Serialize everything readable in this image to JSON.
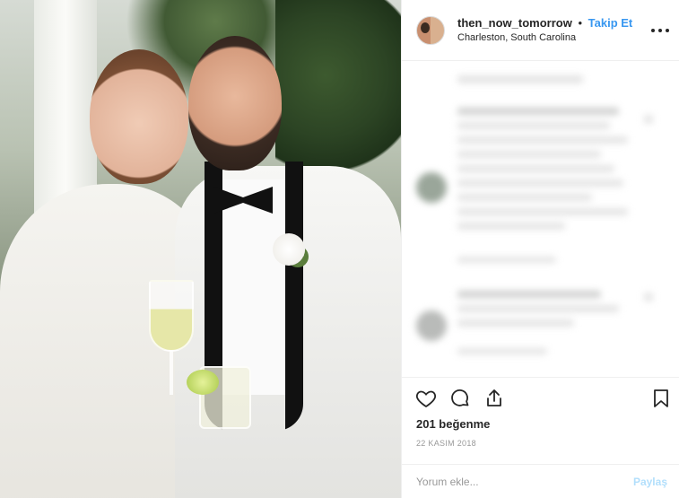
{
  "header": {
    "username": "then_now_tomorrow",
    "separator": "•",
    "follow_label": "Takip Et",
    "location": "Charleston, South Carolina"
  },
  "actions": {
    "like_icon": "heart-icon",
    "comment_icon": "comment-icon",
    "share_icon": "share-icon",
    "save_icon": "bookmark-icon"
  },
  "likes": "201 beğenme",
  "date": "22 KASIM 2018",
  "comment_box": {
    "placeholder": "Yorum ekle...",
    "post_label": "Paylaş"
  },
  "colors": {
    "link_blue": "#3897f0",
    "post_disabled": "#b2dffc",
    "text": "#262626",
    "muted": "#999999"
  }
}
